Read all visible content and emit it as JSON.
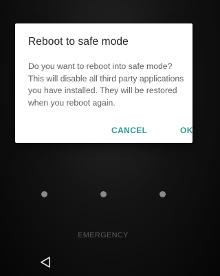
{
  "dialog": {
    "title": "Reboot to safe mode",
    "message": "Do you want to reboot into safe mode? This will disable all third party applications you have installed. They will be restored when you reboot again.",
    "cancel_label": "CANCEL",
    "ok_label": "OK",
    "accent_color": "#2b9c8c"
  },
  "lockscreen": {
    "emergency_label": "EMERGENCY"
  },
  "navbar": {
    "back_icon": "back-triangle-icon"
  }
}
